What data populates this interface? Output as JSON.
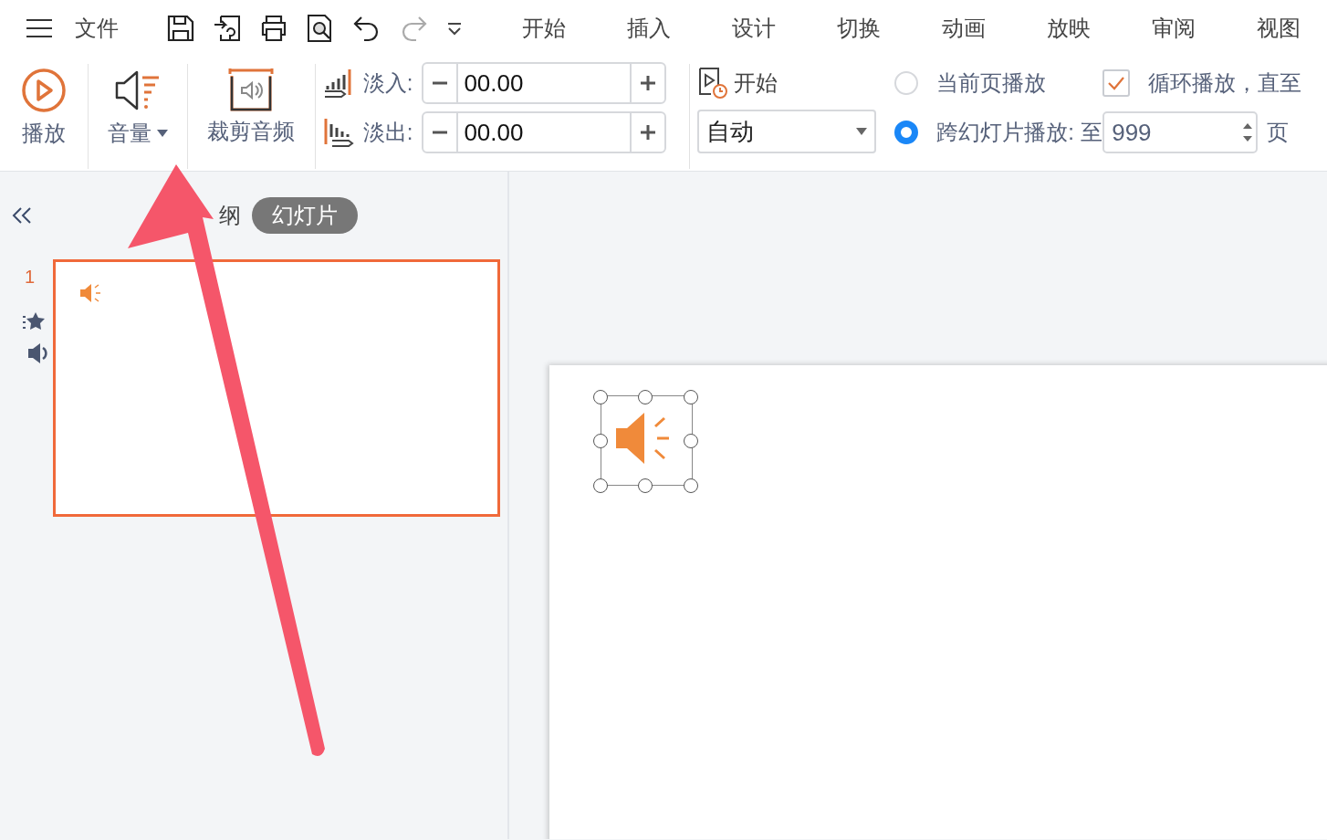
{
  "menu": {
    "file": "文件",
    "tabs": [
      {
        "label": "开始",
        "selected": false
      },
      {
        "label": "插入",
        "selected": false
      },
      {
        "label": "设计",
        "selected": false
      },
      {
        "label": "切换",
        "selected": false
      },
      {
        "label": "动画",
        "selected": false
      },
      {
        "label": "放映",
        "selected": false
      },
      {
        "label": "审阅",
        "selected": false
      },
      {
        "label": "视图",
        "selected": false
      }
    ]
  },
  "ribbon": {
    "play": "播放",
    "volume": "音量",
    "trim": "裁剪音频",
    "fade_in": {
      "label": "淡入:",
      "value": "00.00"
    },
    "fade_out": {
      "label": "淡出:",
      "value": "00.00"
    },
    "start": {
      "label": "开始",
      "value": "自动"
    },
    "play_modes": [
      {
        "label": "当前页播放",
        "selected": false
      },
      {
        "label": "跨幻灯片播放: 至",
        "selected": true
      }
    ],
    "until_page": "999",
    "page_suffix": "页",
    "loop": {
      "label": "循环播放，直至",
      "checked": true
    }
  },
  "panel": {
    "tabs": [
      {
        "label": "纲",
        "selected": false
      },
      {
        "label": "幻灯片",
        "selected": true
      }
    ],
    "slides": [
      {
        "number": "1",
        "selected": true
      }
    ]
  }
}
